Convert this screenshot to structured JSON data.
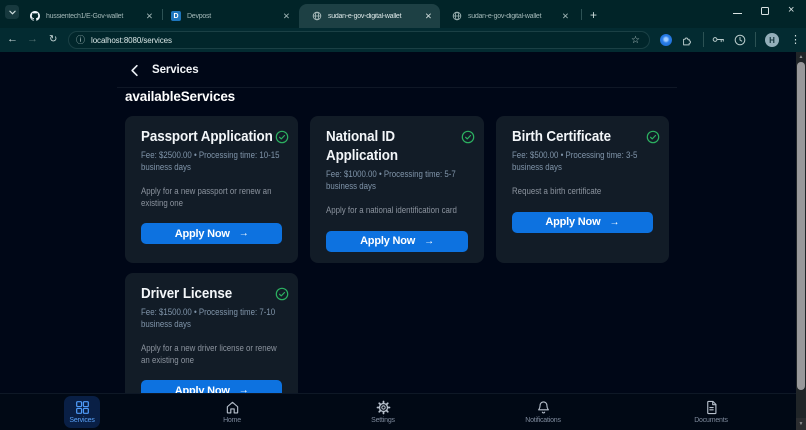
{
  "browser": {
    "tabs": [
      {
        "title": "hussientech1/E-Gov-wallet",
        "icon": "github",
        "active": false
      },
      {
        "title": "Devpost",
        "icon": "devpost",
        "active": false
      },
      {
        "title": "sudan-e-gov-digital-wallet",
        "icon": "globe",
        "active": true
      },
      {
        "title": "sudan-e-gov-digital-wallet",
        "icon": "globe",
        "active": false
      }
    ],
    "new_tab_label": "+",
    "devpost_initial": "D",
    "address_url": "localhost:8080/services",
    "profile_initial": "H"
  },
  "app": {
    "header_title": "Services",
    "section_title": "availableServices",
    "services": [
      {
        "name": "Passport Application",
        "fee": "Fee: $2500.00 • Processing time: 10-15 business days",
        "description": "Apply for a new passport or renew an existing one",
        "cta": "Apply Now"
      },
      {
        "name": "National ID Application",
        "fee": "Fee: $1000.00 • Processing time: 5-7 business days",
        "description": "Apply for a national identification card",
        "cta": "Apply Now"
      },
      {
        "name": "Birth Certificate",
        "fee": "Fee: $500.00 • Processing time: 3-5 business days",
        "description": "Request a birth certificate",
        "cta": "Apply Now"
      },
      {
        "name": "Driver License",
        "fee": "Fee: $1500.00 • Processing time: 7-10 business days",
        "description": "Apply for a new driver license or renew an existing one",
        "cta": "Apply Now"
      }
    ],
    "nav_items": [
      {
        "label": "Services",
        "active": true
      },
      {
        "label": "Home",
        "active": false
      },
      {
        "label": "Settings",
        "active": false
      },
      {
        "label": "Notifications",
        "active": false
      },
      {
        "label": "Documents",
        "active": false
      }
    ],
    "colors": {
      "accent": "#0d72e0",
      "success": "#2cb161",
      "nav_active": "#5aa2f8",
      "page_bg": "#000717",
      "card_bg": "#121c27"
    }
  }
}
